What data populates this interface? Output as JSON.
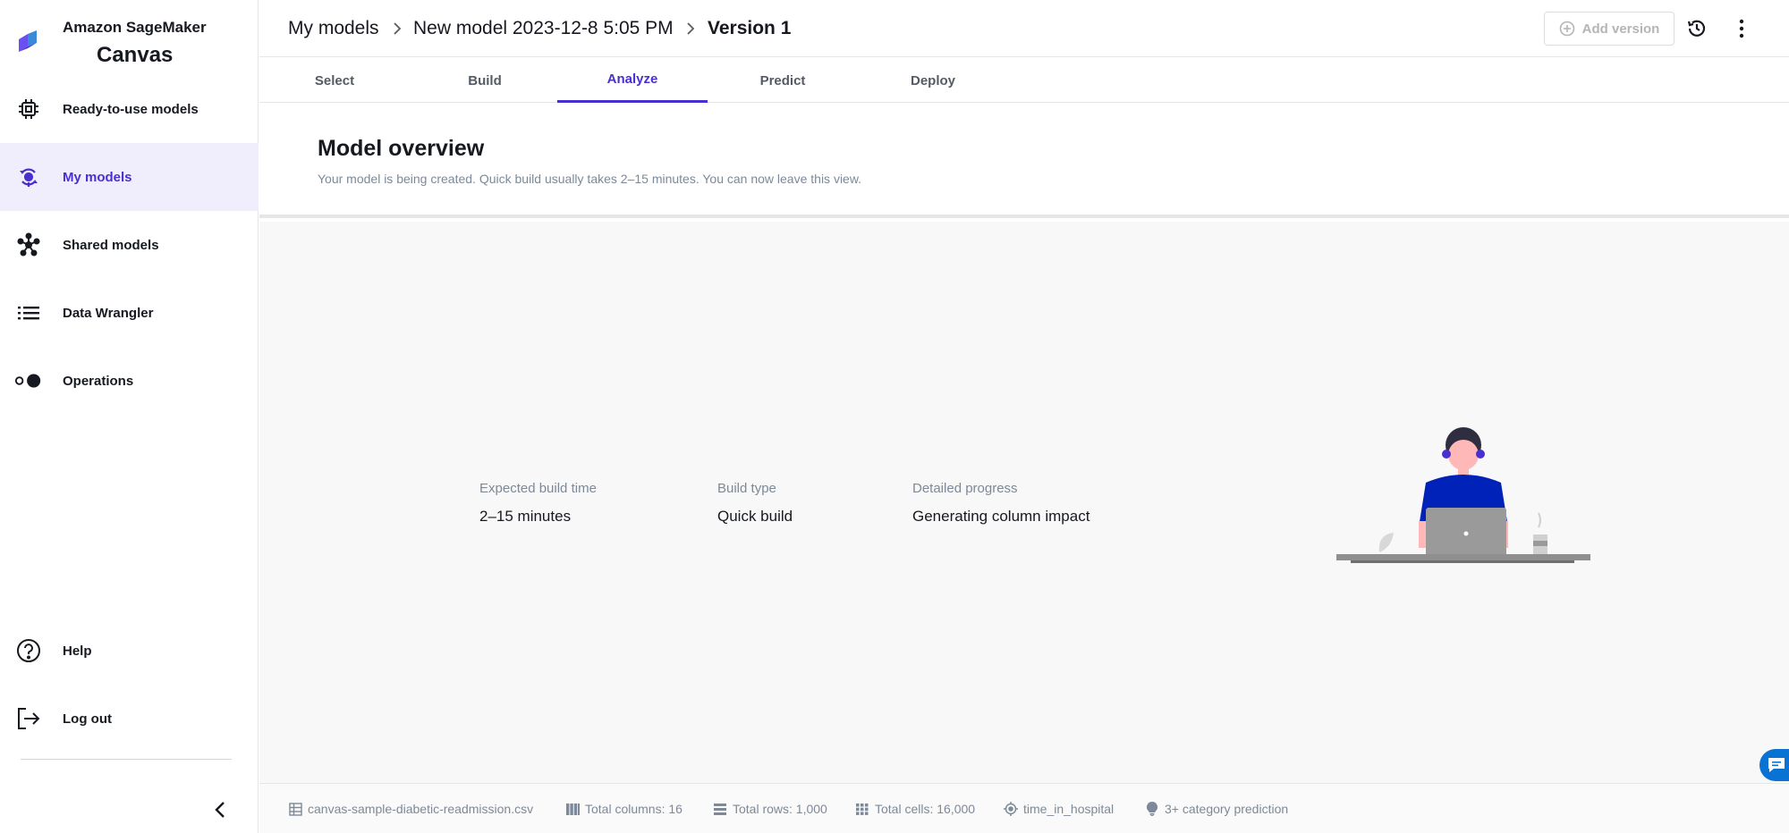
{
  "brand": {
    "line1": "Amazon SageMaker",
    "line2": "Canvas"
  },
  "sidebar": {
    "items": [
      {
        "label": "Ready-to-use models",
        "icon": "chip-icon"
      },
      {
        "label": "My models",
        "icon": "model-bulb-icon",
        "active": true
      },
      {
        "label": "Shared models",
        "icon": "network-icon"
      },
      {
        "label": "Data Wrangler",
        "icon": "list-icon"
      },
      {
        "label": "Operations",
        "icon": "toggle-dots-icon"
      }
    ],
    "bottom_items": [
      {
        "label": "Help",
        "icon": "help-circle-icon"
      },
      {
        "label": "Log out",
        "icon": "logout-icon"
      }
    ]
  },
  "breadcrumb": {
    "items": [
      "My models",
      "New model 2023-12-8 5:05 PM",
      "Version 1"
    ]
  },
  "header": {
    "add_version_label": "Add version"
  },
  "tabs": [
    "Select",
    "Build",
    "Analyze",
    "Predict",
    "Deploy"
  ],
  "active_tab": "Analyze",
  "overview": {
    "title": "Model overview",
    "subtitle": "Your model is being created. Quick build usually takes 2–15 minutes. You can now leave this view."
  },
  "stats": [
    {
      "label": "Expected build time",
      "value": "2–15 minutes"
    },
    {
      "label": "Build type",
      "value": "Quick build"
    },
    {
      "label": "Detailed progress",
      "value": "Generating column impact"
    }
  ],
  "footer": {
    "items": [
      {
        "text": "canvas-sample-diabetic-readmission.csv",
        "icon": "table-icon"
      },
      {
        "text": "Total columns: 16",
        "icon": "columns-icon"
      },
      {
        "text": "Total rows: 1,000",
        "icon": "rows-icon"
      },
      {
        "text": "Total cells: 16,000",
        "icon": "grid-icon"
      },
      {
        "text": "time_in_hospital",
        "icon": "target-icon"
      },
      {
        "text": "3+ category prediction",
        "icon": "lightbulb-icon"
      }
    ]
  },
  "colors": {
    "accent": "#4a2fd0",
    "active_bg": "#f0eefd",
    "muted_text": "#7d8998",
    "chat_blue": "#0972d3"
  }
}
